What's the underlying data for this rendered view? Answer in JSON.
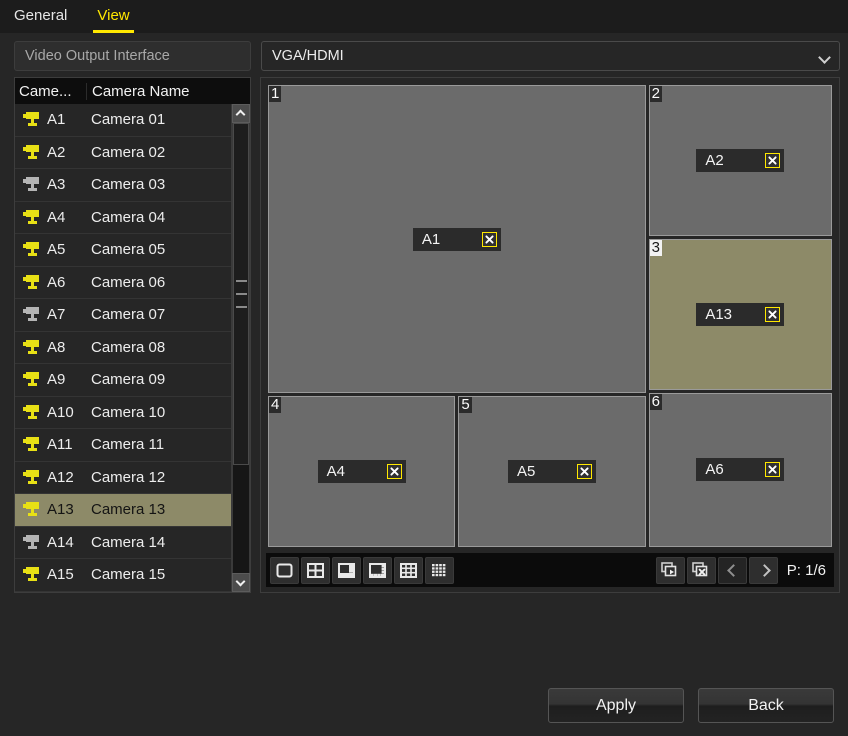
{
  "tabs": [
    {
      "label": "General",
      "active": false
    },
    {
      "label": "View",
      "active": true
    }
  ],
  "settings": {
    "video_output_label": "Video Output Interface",
    "video_output_value": "VGA/HDMI"
  },
  "camera_list": {
    "header_no": "Came...",
    "header_name": "Camera Name",
    "rows": [
      {
        "no": "A1",
        "name": "Camera 01",
        "icon": "camera-icon",
        "enabled": true,
        "selected": false
      },
      {
        "no": "A2",
        "name": "Camera 02",
        "icon": "camera-icon",
        "enabled": true,
        "selected": false
      },
      {
        "no": "A3",
        "name": "Camera 03",
        "icon": "camera-icon",
        "enabled": false,
        "selected": false
      },
      {
        "no": "A4",
        "name": "Camera 04",
        "icon": "camera-icon",
        "enabled": true,
        "selected": false
      },
      {
        "no": "A5",
        "name": "Camera 05",
        "icon": "camera-icon",
        "enabled": true,
        "selected": false
      },
      {
        "no": "A6",
        "name": "Camera 06",
        "icon": "camera-icon",
        "enabled": true,
        "selected": false
      },
      {
        "no": "A7",
        "name": "Camera 07",
        "icon": "camera-icon",
        "enabled": false,
        "selected": false
      },
      {
        "no": "A8",
        "name": "Camera 08",
        "icon": "camera-icon",
        "enabled": true,
        "selected": false
      },
      {
        "no": "A9",
        "name": "Camera 09",
        "icon": "camera-icon",
        "enabled": true,
        "selected": false
      },
      {
        "no": "A10",
        "name": "Camera 10",
        "icon": "camera-icon",
        "enabled": true,
        "selected": false
      },
      {
        "no": "A11",
        "name": "Camera 11",
        "icon": "camera-icon",
        "enabled": true,
        "selected": false
      },
      {
        "no": "A12",
        "name": "Camera 12",
        "icon": "camera-icon",
        "enabled": true,
        "selected": false
      },
      {
        "no": "A13",
        "name": "Camera 13",
        "icon": "camera-icon",
        "enabled": true,
        "selected": true
      },
      {
        "no": "A14",
        "name": "Camera 14",
        "icon": "camera-icon",
        "enabled": false,
        "selected": false
      },
      {
        "no": "A15",
        "name": "Camera 15",
        "icon": "camera-icon",
        "enabled": true,
        "selected": false
      }
    ],
    "scroll_up_icon": "chevron-up-icon",
    "scroll_down_icon": "chevron-down-icon"
  },
  "preview": {
    "layout": "1+5",
    "cells": [
      {
        "number": "1",
        "camera": "A1",
        "selected": false,
        "remove_icon": "close-icon"
      },
      {
        "number": "2",
        "camera": "A2",
        "selected": false,
        "remove_icon": "close-icon"
      },
      {
        "number": "3",
        "camera": "A13",
        "selected": true,
        "remove_icon": "close-icon"
      },
      {
        "number": "4",
        "camera": "A4",
        "selected": false,
        "remove_icon": "close-icon"
      },
      {
        "number": "5",
        "camera": "A5",
        "selected": false,
        "remove_icon": "close-icon"
      },
      {
        "number": "6",
        "camera": "A6",
        "selected": false,
        "remove_icon": "close-icon"
      }
    ]
  },
  "toolbar": {
    "layout_buttons": [
      {
        "name": "layout-1x1",
        "icon": "layout-single-icon",
        "active": false
      },
      {
        "name": "layout-2x2",
        "icon": "layout-quad-icon",
        "active": false
      },
      {
        "name": "layout-1p5",
        "icon": "layout-one-plus-five-icon",
        "active": true
      },
      {
        "name": "layout-1p7",
        "icon": "layout-one-plus-seven-icon",
        "active": false
      },
      {
        "name": "layout-3x3",
        "icon": "layout-nine-icon",
        "active": false
      },
      {
        "name": "layout-4x4",
        "icon": "layout-sixteen-icon",
        "active": false
      }
    ],
    "start_all_icon": "start-all-live-view-icon",
    "clear_all_icon": "clear-all-live-view-icon",
    "prev_icon": "chevron-left-icon",
    "next_icon": "chevron-right-icon",
    "page_label": "P: 1/6"
  },
  "footer": {
    "apply_label": "Apply",
    "back_label": "Back"
  },
  "colors": {
    "accent": "#ffe800",
    "selection": "#8d8a68",
    "cell": "#6b6b6b",
    "background": "#262626"
  }
}
